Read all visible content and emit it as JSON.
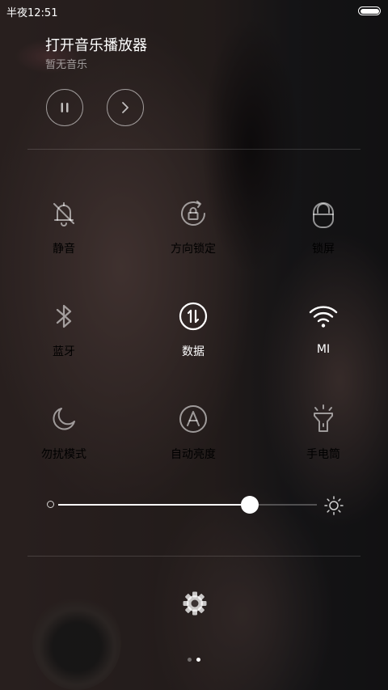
{
  "status_bar": {
    "time": "半夜12:51",
    "battery_level": 1.0
  },
  "music": {
    "title": "打开音乐播放器",
    "subtitle": "暂无音乐",
    "play_pause_icon": "pause-icon",
    "next_icon": "chevron-right-icon"
  },
  "toggles": [
    {
      "label": "静音",
      "icon": "bell-off-icon",
      "active": false
    },
    {
      "label": "方向锁定",
      "icon": "rotation-lock-icon",
      "active": false
    },
    {
      "label": "锁屏",
      "icon": "lock-icon",
      "active": false
    },
    {
      "label": "蓝牙",
      "icon": "bluetooth-icon",
      "active": false
    },
    {
      "label": "数据",
      "icon": "mobile-data-icon",
      "active": true
    },
    {
      "label": "MI",
      "icon": "wifi-icon",
      "active": true
    },
    {
      "label": "勿扰模式",
      "icon": "moon-icon",
      "active": false
    },
    {
      "label": "自动亮度",
      "icon": "auto-brightness-icon",
      "active": false
    },
    {
      "label": "手电筒",
      "icon": "flashlight-icon",
      "active": false
    }
  ],
  "brightness": {
    "level": 0.74,
    "min_icon": "brightness-low-icon",
    "max_icon": "sun-icon"
  },
  "settings": {
    "icon": "gear-icon"
  },
  "pager": {
    "pages": 2,
    "current": 1
  },
  "colors": {
    "active": "#ffffff",
    "inactive": "rgba(255,255,255,0.5)"
  }
}
